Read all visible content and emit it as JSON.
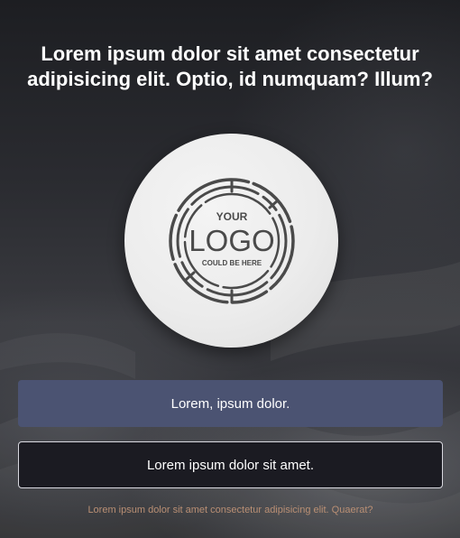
{
  "heading": "Lorem ipsum dolor sit amet consectetur adipisicing elit. Optio, id numquam? Illum?",
  "logo": {
    "icon": "logo-badge-icon",
    "top_text": "YOUR",
    "main_text": "LOGO",
    "bottom_text": "COULD BE HERE"
  },
  "buttons": {
    "primary_label": "Lorem, ipsum dolor.",
    "secondary_label": "Lorem ipsum dolor sit amet."
  },
  "footnote": "Lorem ipsum dolor sit amet consectetur adipisicing elit. Quaerat?",
  "colors": {
    "primary_button": "#4b5372",
    "secondary_button": "#1b1b22",
    "footnote_text": "#b98f74",
    "logo_ink": "#4a4a4a"
  }
}
